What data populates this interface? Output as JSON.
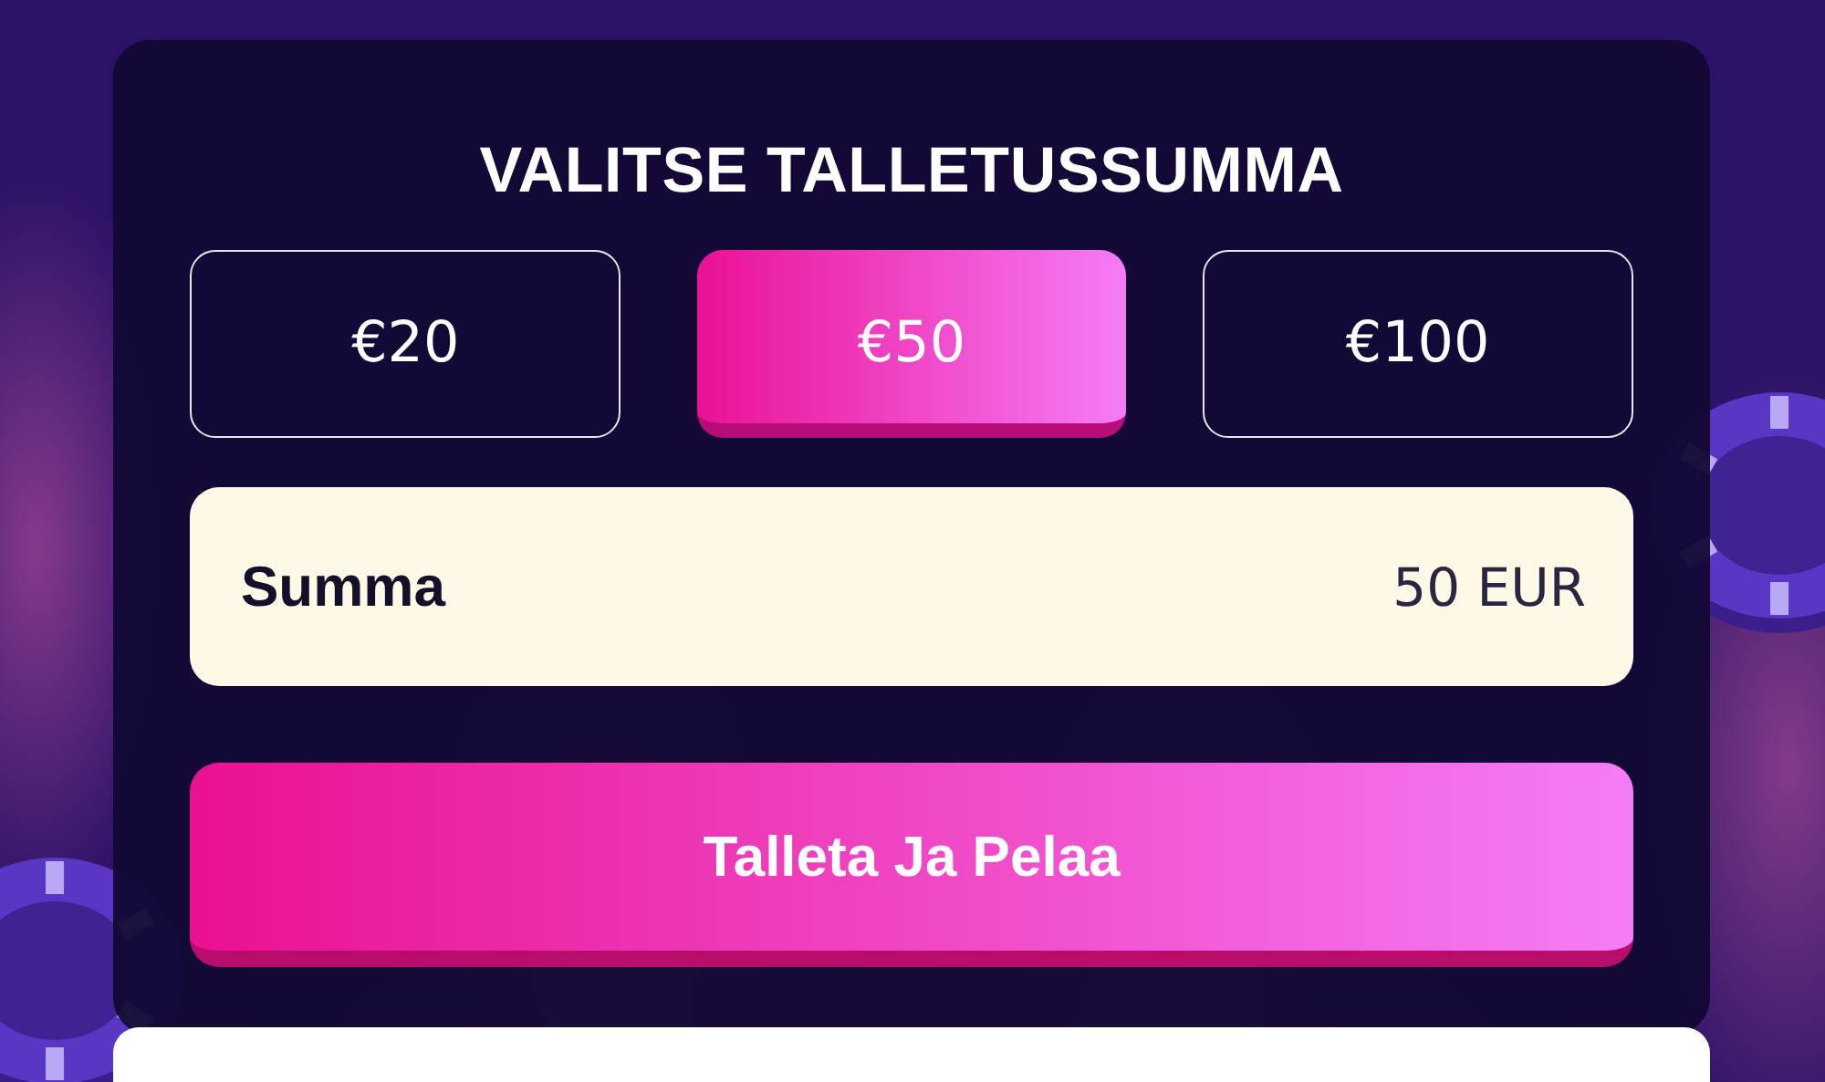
{
  "title": "VALITSE TALLETUSSUMMA",
  "amounts": [
    {
      "label": "€20",
      "selected": false
    },
    {
      "label": "€50",
      "selected": true
    },
    {
      "label": "€100",
      "selected": false
    }
  ],
  "amount_field": {
    "label": "Summa",
    "value": "50 EUR"
  },
  "submit_button": {
    "label": "Talleta Ja Pelaa"
  }
}
